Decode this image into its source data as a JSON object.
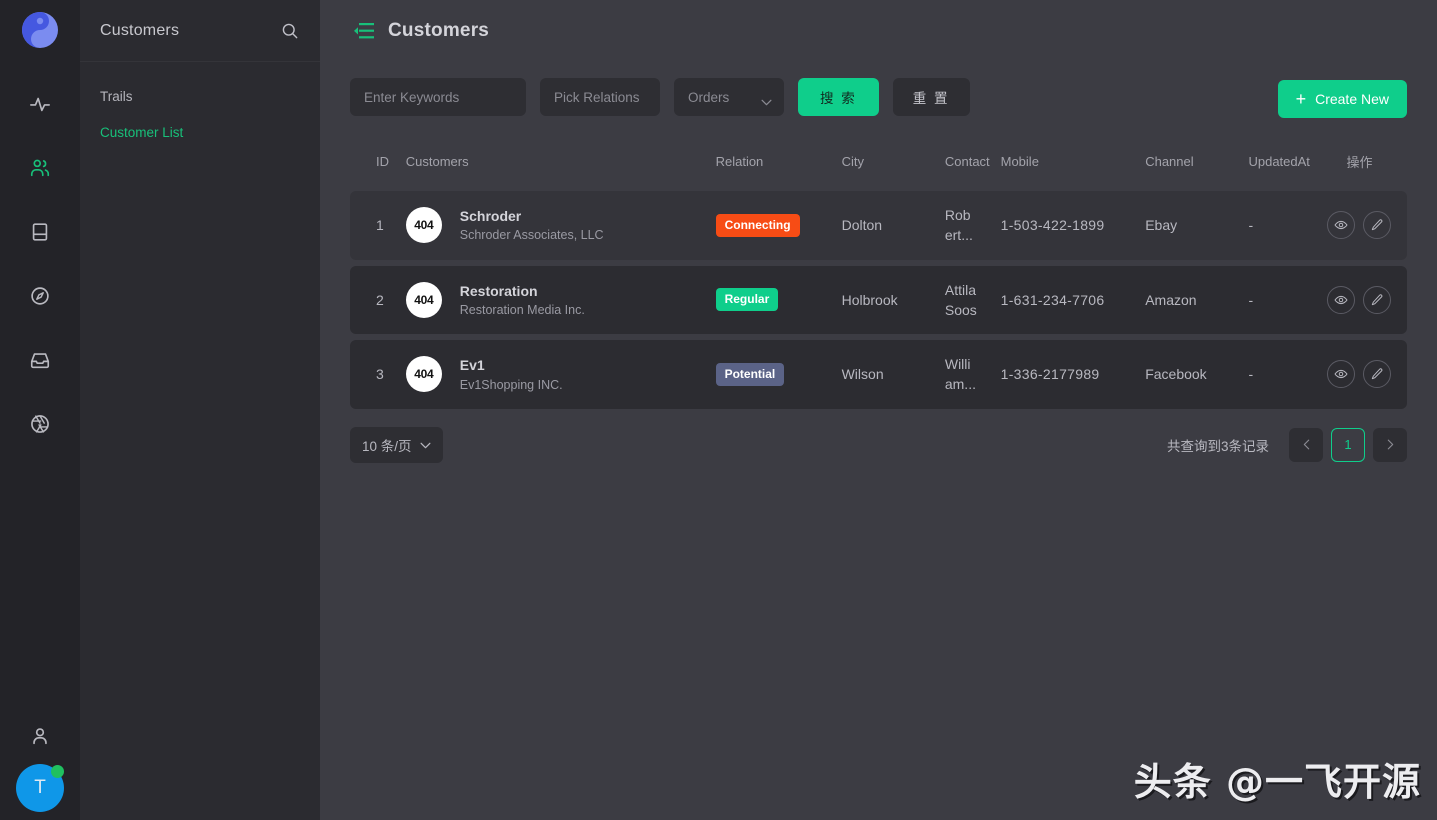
{
  "brand": {
    "logo_name": "yin-yang-logo",
    "colors": {
      "accent_green": "#0fce8b",
      "active_green": "#18c07a",
      "avatar_blue": "#0f97e8",
      "online_dot": "#20c060"
    }
  },
  "rail": {
    "items": [
      {
        "name": "activity-icon",
        "label": "Activity",
        "active": false
      },
      {
        "name": "users-icon",
        "label": "Customers",
        "active": true
      },
      {
        "name": "book-icon",
        "label": "Book",
        "active": false
      },
      {
        "name": "compass-icon",
        "label": "Discover",
        "active": false
      },
      {
        "name": "inbox-icon",
        "label": "Inbox",
        "active": false
      },
      {
        "name": "aperture-icon",
        "label": "Aperture",
        "active": false
      }
    ],
    "user_icon": "person-icon",
    "avatar_initial": "T"
  },
  "sidebar": {
    "title": "Customers",
    "search_icon": "search-icon",
    "items": [
      {
        "label": "Trails",
        "active": false
      },
      {
        "label": "Customer List",
        "active": true
      }
    ]
  },
  "header": {
    "fold_icon": "menu-fold-icon",
    "title": "Customers"
  },
  "toolbar": {
    "keywords_placeholder": "Enter Keywords",
    "keywords_value": "",
    "relations_placeholder": "Pick Relations",
    "relations_value": "",
    "orders_label": "Orders",
    "orders_chevron": "chevron-down-icon",
    "search_label": "搜 索",
    "reset_label": "重 置",
    "create_label": "Create New",
    "create_icon": "plus-icon"
  },
  "table": {
    "headers": [
      "ID",
      "Customers",
      "Relation",
      "City",
      "Contact",
      "Mobile",
      "Channel",
      "UpdatedAt",
      "操作"
    ],
    "rows": [
      {
        "id": "1",
        "avatar": "404",
        "name": "Schroder",
        "company": "Schroder Associates, LLC",
        "relation": "Connecting",
        "relation_color": "#f74c15",
        "city": "Dolton",
        "contact": "Rob ert...",
        "mobile": "1-503-422-1899",
        "channel": "Ebay",
        "updated_at": "-",
        "highlighted": true,
        "view_icon": "eye-icon",
        "edit_icon": "pencil-icon"
      },
      {
        "id": "2",
        "avatar": "404",
        "name": "Restoration",
        "company": "Restoration Media Inc.",
        "relation": "Regular",
        "relation_color": "#0fce8b",
        "city": "Holbrook",
        "contact": "Attila Soos",
        "mobile": "1-631-234-7706",
        "channel": "Amazon",
        "updated_at": "-",
        "highlighted": false,
        "view_icon": "eye-icon",
        "edit_icon": "pencil-icon"
      },
      {
        "id": "3",
        "avatar": "404",
        "name": "Ev1",
        "company": "Ev1Shopping INC.",
        "relation": "Potential",
        "relation_color": "#5b6387",
        "city": "Wilson",
        "contact": "Willi am...",
        "mobile": "1-336-2177989",
        "channel": "Facebook",
        "updated_at": "-",
        "highlighted": false,
        "view_icon": "eye-icon",
        "edit_icon": "pencil-icon"
      }
    ]
  },
  "pagination": {
    "per_page_label": "10 条/页",
    "per_page_chevron": "chevron-down-icon",
    "total_text": "共查询到3条记录",
    "prev_icon": "chevron-left-icon",
    "next_icon": "chevron-right-icon",
    "current_page": "1"
  },
  "watermark": {
    "text": "头条 @一飞开源"
  }
}
